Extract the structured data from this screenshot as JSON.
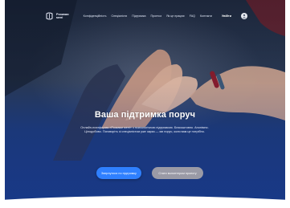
{
  "header": {
    "logo_text_line1": "Розкажи",
    "logo_text_line2": "мені",
    "menu": [
      "Конфіденційність",
      "Спеціалісти",
      "Підтримка",
      "Прогнoз",
      "Як це працює",
      "FAQ",
      "Контакти"
    ],
    "login_label": "Увійти"
  },
  "hero": {
    "title": "Ваша підтримка поруч",
    "description": "Онлайн-платформа «Розкажи мені» з психологічною підтримкою. Безкоштовно. Анонімно. Цілодобово. Поговоріть зі спеціалістом уже зараз — ми поруч, коли вам це потрібно.",
    "primary_button": "Звернутися по підтримку",
    "secondary_button": "Стати волонтером проекту"
  },
  "colors": {
    "hero_blue": "#1a3a86",
    "primary_button": "#2f80ff",
    "secondary_button": "#9a9aa6"
  }
}
